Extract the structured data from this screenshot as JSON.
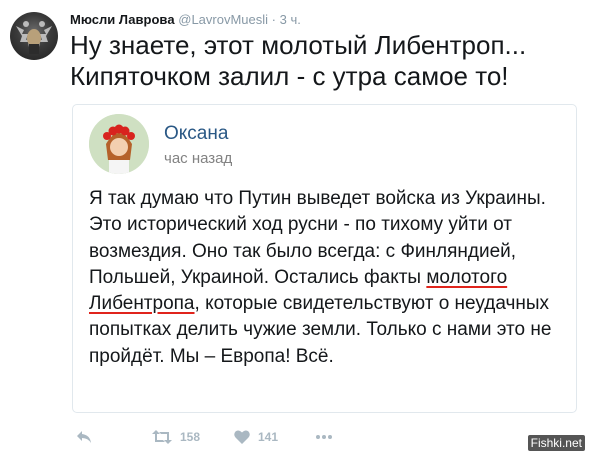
{
  "tweet": {
    "author_name": "Мюсли Лавровa",
    "author_handle": "@LavrovMuesli",
    "separator": "·",
    "time": "3 ч.",
    "text_line1": "Ну знаете, этот молотый Либентроп...",
    "text_line2": "Кипяточком залил - с утра самое то!"
  },
  "quote": {
    "name": "Оксана",
    "time": "час назад",
    "body_before": "Я так думаю что Путин выведет войска из Украины. Это исторический ход русни - по тихому уйти от возмездия. Оно так было всегда: с Финляндией, Польшей, Украиной. Остались факты ",
    "body_highlight": "молотого Либентропа",
    "body_after": ", которые свидетельствуют о неудачных попытках делить чужие земли. Только с нами это не пройдёт. Мы – Европа! Всё."
  },
  "actions": {
    "retweet_count": "158",
    "like_count": "141"
  },
  "icons": {
    "reply": "reply-icon",
    "retweet": "retweet-icon",
    "like": "heart-icon",
    "more": "more-icon"
  },
  "colors": {
    "quote_name": "#2a5885",
    "underline": "#e0241c",
    "action_icon": "#aab8c2"
  },
  "watermark": "Fishki.net"
}
